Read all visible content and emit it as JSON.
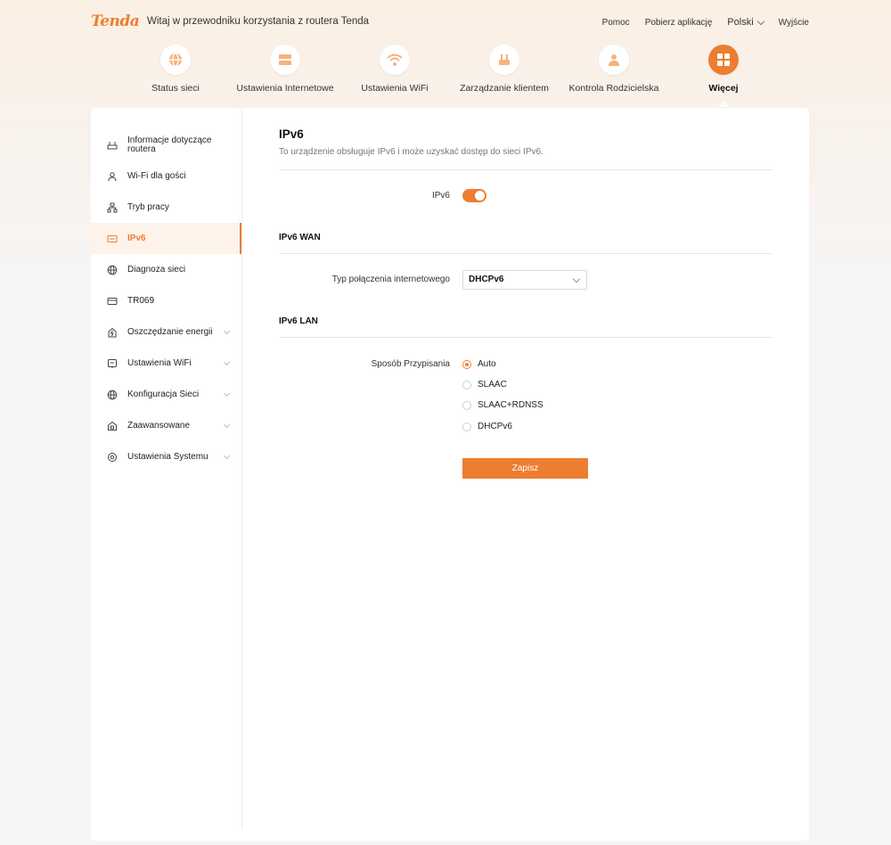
{
  "header": {
    "logo": "Tenda",
    "welcome": "Witaj w przewodniku korzystania z routera Tenda",
    "links": {
      "help": "Pomoc",
      "download": "Pobierz aplikację",
      "language": "Polski",
      "logout": "Wyjście"
    }
  },
  "nav": {
    "items": [
      {
        "label": "Status sieci",
        "icon": "globe-icon"
      },
      {
        "label": "Ustawienia Internetowe",
        "icon": "internet-settings-icon"
      },
      {
        "label": "Ustawienia WiFi",
        "icon": "wifi-icon"
      },
      {
        "label": "Zarządzanie klientem",
        "icon": "client-management-icon"
      },
      {
        "label": "Kontrola Rodzicielska",
        "icon": "parental-control-icon"
      },
      {
        "label": "Więcej",
        "icon": "more-grid-icon",
        "active": true
      }
    ]
  },
  "sidebar": {
    "items": [
      {
        "label": "Informacje dotyczące routera",
        "line1": "Informacje dotyczące",
        "line2": "routera",
        "icon": "router-icon"
      },
      {
        "label": "Wi-Fi dla gości",
        "icon": "guest-icon"
      },
      {
        "label": "Tryb pracy",
        "icon": "network-mode-icon"
      },
      {
        "label": "IPv6",
        "icon": "ipv6-icon",
        "active": true
      },
      {
        "label": "Diagnoza sieci",
        "icon": "globe-icon"
      },
      {
        "label": "TR069",
        "icon": "card-icon"
      },
      {
        "label": "Oszczędzanie energii",
        "icon": "energy-icon",
        "expandable": true
      },
      {
        "label": "Ustawienia WiFi",
        "icon": "wifi-settings-icon",
        "expandable": true
      },
      {
        "label": "Konfiguracja Sieci",
        "icon": "globe-icon",
        "expandable": true
      },
      {
        "label": "Zaawansowane",
        "icon": "advanced-icon",
        "expandable": true
      },
      {
        "label": "Ustawienia Systemu",
        "icon": "system-settings-icon",
        "expandable": true
      }
    ]
  },
  "page": {
    "title": "IPv6",
    "description": "To urządzenie obsługuje IPv6 i może uzyskać dostęp do sieci IPv6.",
    "ipv6_toggle_label": "IPv6",
    "ipv6_enabled": true,
    "wan": {
      "section_title": "IPv6 WAN",
      "connection_type_label": "Typ połączenia internetowego",
      "connection_type_value": "DHCPv6"
    },
    "lan": {
      "section_title": "IPv6 LAN",
      "assignment_label": "Sposób Przypisania",
      "options": [
        "Auto",
        "SLAAC",
        "SLAAC+RDNSS",
        "DHCPv6"
      ],
      "selected": "Auto"
    },
    "save_label": "Zapisz"
  },
  "colors": {
    "accent": "#ed7d31",
    "active_bg": "#fdf3ea"
  }
}
